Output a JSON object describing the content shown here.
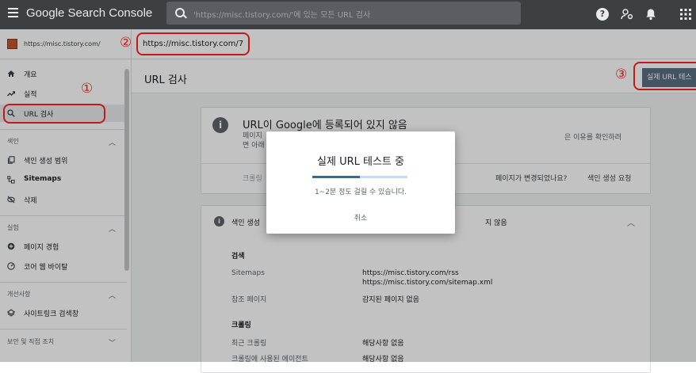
{
  "app": {
    "title": "Google Search Console"
  },
  "search": {
    "placeholder": "'https://misc.tistory.com/'에 있는 모든 URL 검사"
  },
  "sidebar": {
    "property": "https://misc.tistory.com/",
    "items_top": [
      {
        "label": "개요",
        "icon": "home-icon"
      },
      {
        "label": "실적",
        "icon": "trending-icon"
      },
      {
        "label": "URL 검사",
        "icon": "search-icon",
        "active": true
      }
    ],
    "sections": [
      {
        "label": "색인",
        "items": [
          {
            "label": "색인 생성 범위"
          },
          {
            "label": "Sitemaps"
          },
          {
            "label": "삭제"
          }
        ]
      },
      {
        "label": "실험",
        "items": [
          {
            "label": "페이지 경험"
          },
          {
            "label": "코어 웹 바이탈"
          }
        ]
      },
      {
        "label": "개선사항",
        "items": [
          {
            "label": "사이트링크 검색창"
          }
        ]
      },
      {
        "label": "보안 및 직접 조치"
      }
    ]
  },
  "main": {
    "inspected_url": "https://misc.tistory.com/7",
    "page_title": "URL 검사",
    "live_test_button": "실제 URL 테스",
    "status_card": {
      "title": "URL이 Google에 등록되어 있지 않음",
      "desc_line1": "페이지",
      "desc_line2": "면 아래",
      "desc_right": "은 이유를 확인하려",
      "footer_left": "크롤링",
      "footer_question": "페이지가 변경되었나요?",
      "footer_request": "색인 생성 요청"
    },
    "detail_card": {
      "title_left": "색인 생성",
      "title_right": "지 않음",
      "discovery_label": "검색",
      "sitemaps_label": "Sitemaps",
      "sitemaps_values": [
        "https://misc.tistory.com/rss",
        "https://misc.tistory.com/sitemap.xml"
      ],
      "referring_label": "참조 페이지",
      "referring_value": "감지된 페이지 없음",
      "crawl_label": "크롤링",
      "last_crawl_label": "최근 크롤링",
      "last_crawl_value": "해당사항 없음",
      "agent_label": "크롤링에 사용된 에이전트",
      "agent_value": "해당사항 없음"
    }
  },
  "modal": {
    "title": "실제 URL 테스트 중",
    "progress": 0.5,
    "subtitle": "1~2분 정도 걸릴 수 있습니다.",
    "cancel": "취소"
  },
  "annotations": {
    "n1": "①",
    "n2": "②",
    "n3": "③",
    "color": "#c21a1a"
  }
}
